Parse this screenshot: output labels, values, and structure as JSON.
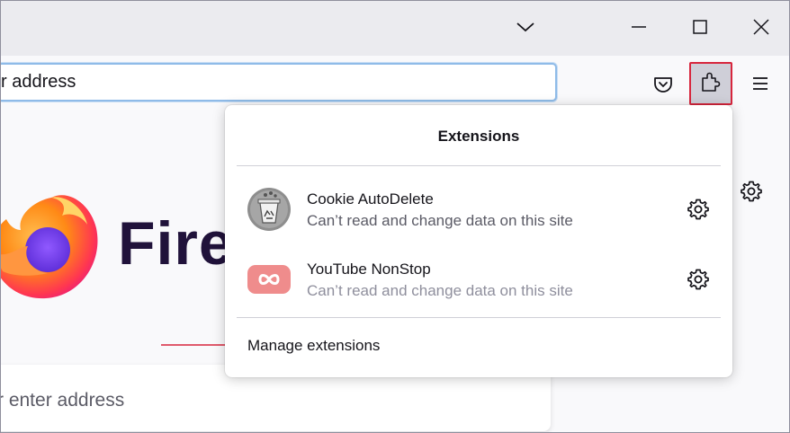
{
  "window": {
    "controls": [
      "chevron-down-icon",
      "minimize-icon",
      "maximize-icon",
      "close-icon"
    ]
  },
  "navbar": {
    "url_placeholder": "r address",
    "buttons": [
      "pocket-icon",
      "extensions-icon",
      "menu-icon"
    ]
  },
  "content": {
    "wordmark": "Firet",
    "search_placeholder": "r enter address"
  },
  "extensions_panel": {
    "title": "Extensions",
    "items": [
      {
        "name": "Cookie AutoDelete",
        "description": "Can’t read and change data on this site",
        "icon": "cookie-autodelete-icon"
      },
      {
        "name": "YouTube NonStop",
        "description": "Can’t read and change data on this site",
        "icon": "youtube-nonstop-icon"
      }
    ],
    "manage_label": "Manage extensions"
  },
  "colors": {
    "highlight": "#d7263d",
    "panel_bg": "#ffffff",
    "chrome_bg": "#ebebef"
  }
}
